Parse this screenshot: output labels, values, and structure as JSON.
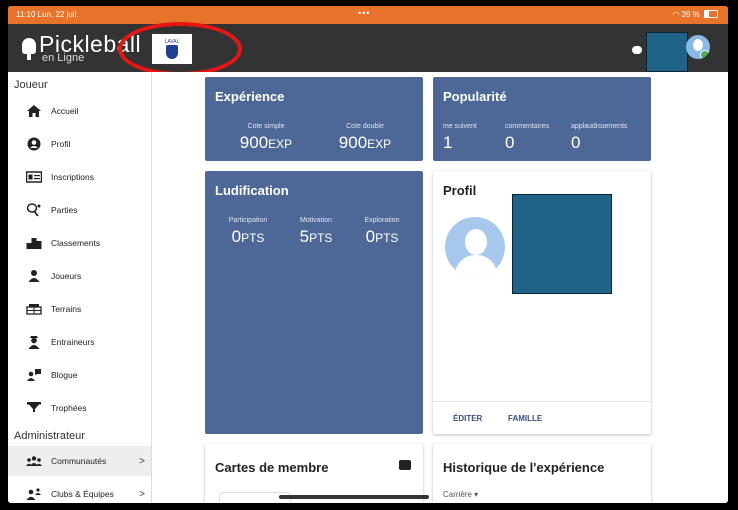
{
  "status": {
    "time": "11:10  Lun. 22 juil.",
    "dots": "•••",
    "battery": "39 %"
  },
  "app": {
    "logo_text": "Pickleball",
    "logo_sub": "en Ligne",
    "club_logo_text": "LAVAL"
  },
  "sidebar": {
    "section_joueur": "Joueur",
    "items": [
      {
        "label": "Accueil",
        "icon": "home-icon"
      },
      {
        "label": "Profil",
        "icon": "account-circle-icon"
      },
      {
        "label": "Inscriptions",
        "icon": "id-card-icon"
      },
      {
        "label": "Parties",
        "icon": "paddle-icon"
      },
      {
        "label": "Classements",
        "icon": "podium-icon"
      },
      {
        "label": "Joueurs",
        "icon": "person-icon"
      },
      {
        "label": "Terrains",
        "icon": "court-icon"
      },
      {
        "label": "Entraineurs",
        "icon": "coach-icon"
      },
      {
        "label": "Blogue",
        "icon": "blog-icon"
      },
      {
        "label": "Trophées",
        "icon": "trophy-icon"
      }
    ],
    "section_admin": "Administrateur",
    "admin_items": [
      {
        "label": "Communautés",
        "icon": "groups-icon"
      },
      {
        "label": "Clubs & Équipes",
        "icon": "teams-icon"
      }
    ]
  },
  "experience": {
    "title": "Expérience",
    "stats": [
      {
        "caption": "Cote simple",
        "value": "900",
        "unit": "EXP"
      },
      {
        "caption": "Cote double",
        "value": "900",
        "unit": "EXP"
      }
    ]
  },
  "popularite": {
    "title": "Popularité",
    "stats": [
      {
        "caption": "me suivent",
        "value": "1"
      },
      {
        "caption": "commentaires",
        "value": "0"
      },
      {
        "caption": "applaudissements",
        "value": "0"
      }
    ]
  },
  "ludification": {
    "title": "Ludification",
    "stats": [
      {
        "caption": "Participation",
        "value": "0",
        "unit": "PTS"
      },
      {
        "caption": "Motivation",
        "value": "5",
        "unit": "PTS"
      },
      {
        "caption": "Exploration",
        "value": "0",
        "unit": "PTS"
      }
    ]
  },
  "profil": {
    "title": "Profil",
    "edit": "ÉDITER",
    "family": "FAMILLE"
  },
  "cartes": {
    "title": "Cartes de membre"
  },
  "historique": {
    "title": "Historique de l'expérience",
    "filter": "Carrière ▾"
  }
}
